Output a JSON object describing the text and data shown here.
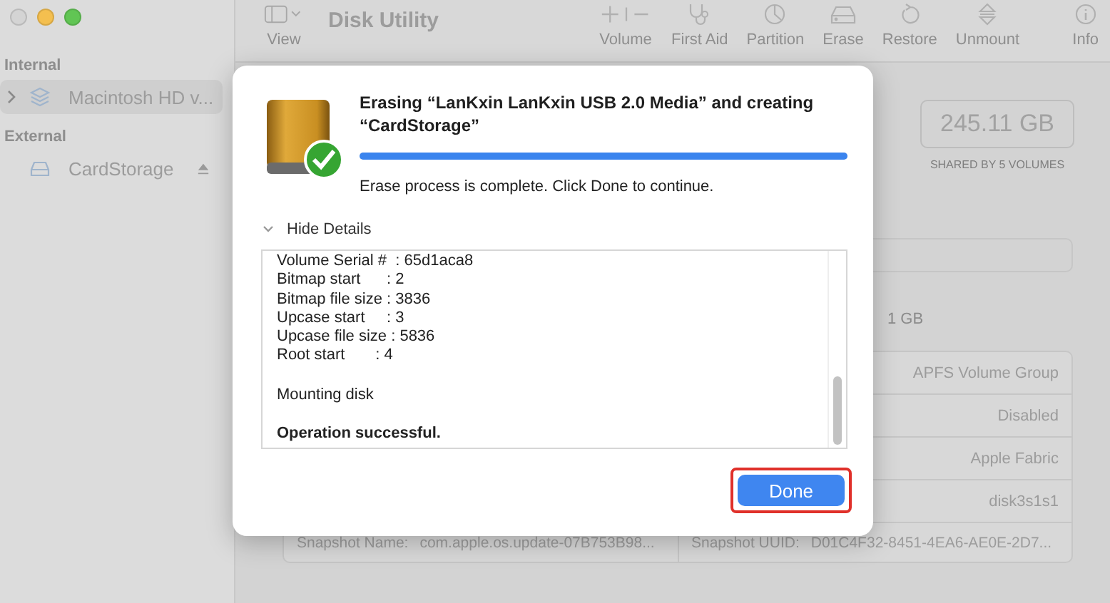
{
  "window": {
    "title": "Disk Utility",
    "traffic_lights": [
      {
        "color": "#d4d4d4"
      },
      {
        "color": "#f4bf4f"
      },
      {
        "color": "#61c554"
      }
    ]
  },
  "sidebar": {
    "sections": [
      {
        "heading": "Internal",
        "items": [
          {
            "label": "Macintosh HD v...",
            "selected": true,
            "expanded": false,
            "kind": "stack"
          }
        ]
      },
      {
        "heading": "External",
        "items": [
          {
            "label": "CardStorage",
            "selected": false,
            "kind": "drive"
          }
        ]
      }
    ]
  },
  "toolbar": {
    "view_label": "View",
    "items": [
      {
        "kind": "volume",
        "label": "Volume"
      },
      {
        "kind": "first_aid",
        "label": "First Aid"
      },
      {
        "kind": "partition",
        "label": "Partition"
      },
      {
        "kind": "erase",
        "label": "Erase"
      },
      {
        "kind": "restore",
        "label": "Restore"
      },
      {
        "kind": "unmount",
        "label": "Unmount"
      },
      {
        "kind": "info",
        "label": "Info"
      }
    ]
  },
  "content": {
    "capacity": "245.11 GB",
    "capacity_note": "SHARED BY 5 VOLUMES",
    "used_fragment": "1 GB",
    "info_rows": [
      "APFS Volume Group",
      "Disabled",
      "Apple Fabric",
      "disk3s1s1"
    ],
    "snapshot": [
      {
        "label": "Snapshot Name:",
        "value": "com.apple.os.update-07B753B98..."
      },
      {
        "label": "Snapshot UUID:",
        "value": "D01C4F32-8451-4EA6-AE0E-2D7..."
      }
    ]
  },
  "dialog": {
    "title": "Erasing “LanKxin LanKxin USB 2.0 Media” and creating “CardStorage”",
    "level": 1,
    "message": "Erase process is complete. Click Done to continue.",
    "details_toggle": {
      "label": "Hide Details",
      "expanded": true
    },
    "log_sections": [
      {
        "bold": false,
        "lines": [
          "Volume Serial #  : 65d1aca8",
          "Bitmap start      : 2",
          "Bitmap file size : 3836",
          "Upcase start     : 3",
          "Upcase file size : 5836",
          "Root start       : 4"
        ]
      },
      {
        "bold": false,
        "lines": [
          "Mounting disk"
        ]
      },
      {
        "bold": true,
        "lines": [
          "Operation successful."
        ]
      }
    ],
    "done_button": {
      "label": "Done",
      "highlighted": true
    }
  }
}
